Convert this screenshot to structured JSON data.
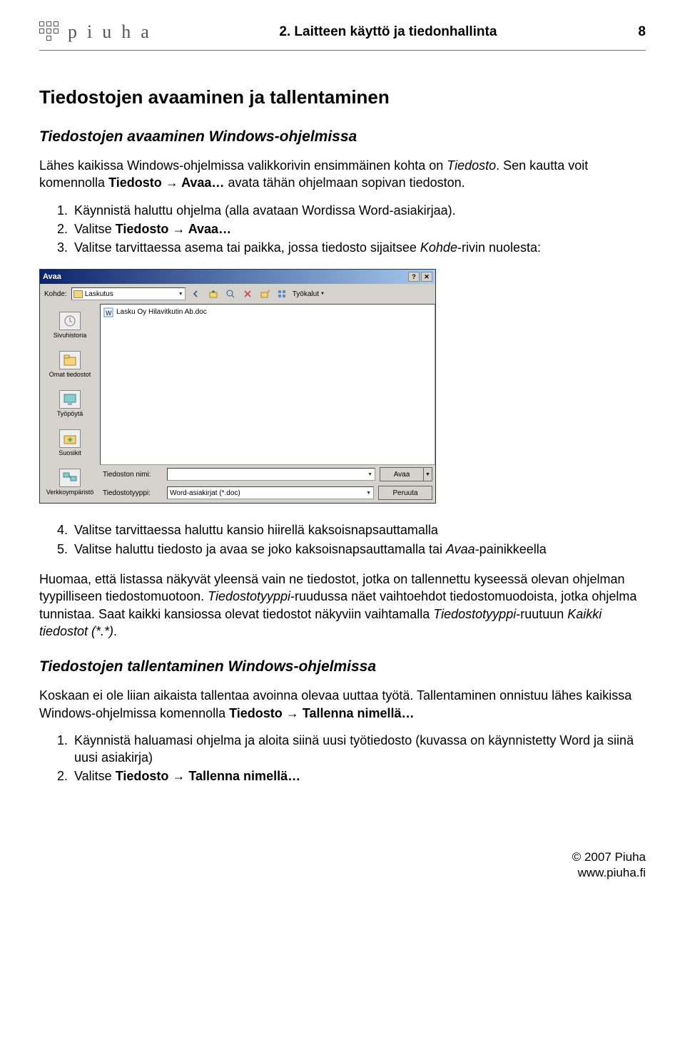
{
  "header": {
    "brand": "piuha",
    "chapter": "2. Laitteen käyttö ja tiedonhallinta",
    "page_number": "8"
  },
  "h1": "Tiedostojen avaaminen ja tallentaminen",
  "h2a": "Tiedostojen avaaminen Windows-ohjelmissa",
  "p1_a": "Lähes kaikissa Windows-ohjelmissa valikkorivin ensimmäinen kohta on ",
  "p1_b": "Tiedosto",
  "p1_c": ". Sen kautta voit komennolla ",
  "p1_d": "Tiedosto → Avaa…",
  "p1_e": " avata tähän ohjelmaan sopivan tiedoston.",
  "steps_a": {
    "1": "Käynnistä haluttu ohjelma (alla avataan Wordissa Word-asiakirjaa).",
    "2_a": "Valitse ",
    "2_b": "Tiedosto → Avaa…",
    "3_a": "Valitse tarvittaessa asema tai paikka, jossa tiedosto sijaitsee ",
    "3_b": "Kohde",
    "3_c": "-rivin nuolesta:"
  },
  "dialog": {
    "title": "Avaa",
    "kohde_label": "Kohde:",
    "kohde_value": "Laskutus",
    "tools_label": "Työkalut",
    "sidebar": {
      "sivuhistoria": "Sivuhistoria",
      "omat": "Omat tiedostot",
      "tyopoyta": "Työpöytä",
      "suosikit": "Suosikit",
      "verkko": "Verkkoympäristö"
    },
    "file1": "Lasku Oy Hilavitkutin Ab.doc",
    "filename_label": "Tiedoston nimi:",
    "filetype_label": "Tiedostotyyppi:",
    "filetype_value": "Word-asiakirjat (*.doc)",
    "btn_open": "Avaa",
    "btn_cancel": "Peruuta"
  },
  "steps_b": {
    "4": "Valitse tarvittaessa haluttu kansio hiirellä kaksoisnapsauttamalla",
    "5_a": "Valitse haluttu tiedosto ja avaa se joko kaksoisnapsauttamalla tai ",
    "5_b": "Avaa",
    "5_c": "-painikkeella"
  },
  "p2_a": "Huomaa, että listassa näkyvät yleensä vain ne tiedostot, jotka on tallennettu kyseessä olevan ohjelman tyypilliseen tiedostomuotoon. ",
  "p2_b": "Tiedostotyyppi",
  "p2_c": "-ruudussa näet vaihtoehdot tiedostomuodoista, jotka ohjelma tunnistaa. Saat kaikki kansiossa olevat tiedostot näkyviin vaihtamalla ",
  "p2_d": "Tiedostotyyppi",
  "p2_e": "-ruutuun ",
  "p2_f": "Kaikki tiedostot (*.*)",
  "p2_g": ".",
  "h2b": "Tiedostojen tallentaminen Windows-ohjelmissa",
  "p3_a": "Koskaan ei ole liian aikaista tallentaa avoinna olevaa uuttaa työtä. Tallentaminen onnistuu lähes kaikissa Windows-ohjelmissa komennolla ",
  "p3_b": "Tiedosto → Tallenna nimellä…",
  "steps_c": {
    "1": "Käynnistä haluamasi ohjelma ja aloita siinä uusi työtiedosto (kuvassa on käynnistetty Word ja siinä uusi asiakirja)",
    "2_a": "Valitse ",
    "2_b": "Tiedosto → Tallenna nimellä…"
  },
  "footer": {
    "line1": "© 2007 Piuha",
    "line2": "www.piuha.fi"
  }
}
